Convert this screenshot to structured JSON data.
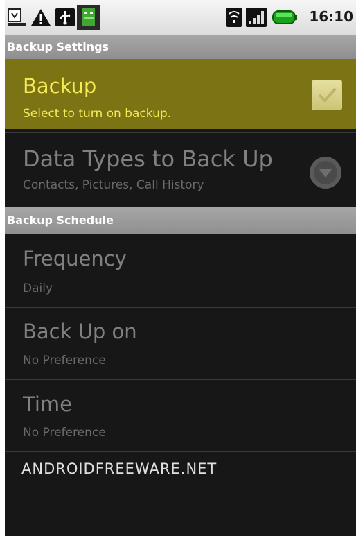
{
  "status_bar": {
    "time": "16:10",
    "icons": [
      "screenshot-download-icon",
      "warning-icon",
      "usb-icon",
      "android-app-icon",
      "wifi-icon",
      "signal-icon",
      "battery-icon"
    ]
  },
  "sections": {
    "settings_header": "Backup Settings",
    "schedule_header": "Backup Schedule"
  },
  "backup": {
    "title": "Backup",
    "summary": "Select to turn on backup.",
    "checked": true
  },
  "data_types": {
    "title": "Data Types to Back Up",
    "summary": "Contacts, Pictures, Call History"
  },
  "frequency": {
    "title": "Frequency",
    "summary": "Daily"
  },
  "back_up_on": {
    "title": "Back Up on",
    "summary": "No Preference"
  },
  "time_pref": {
    "title": "Time",
    "summary": "No Preference"
  },
  "watermark": "ANDROIDFREEWARE.NET",
  "colors": {
    "highlight_bg": "#7b7314",
    "highlight_text": "#f4ec56",
    "background": "#171717"
  }
}
